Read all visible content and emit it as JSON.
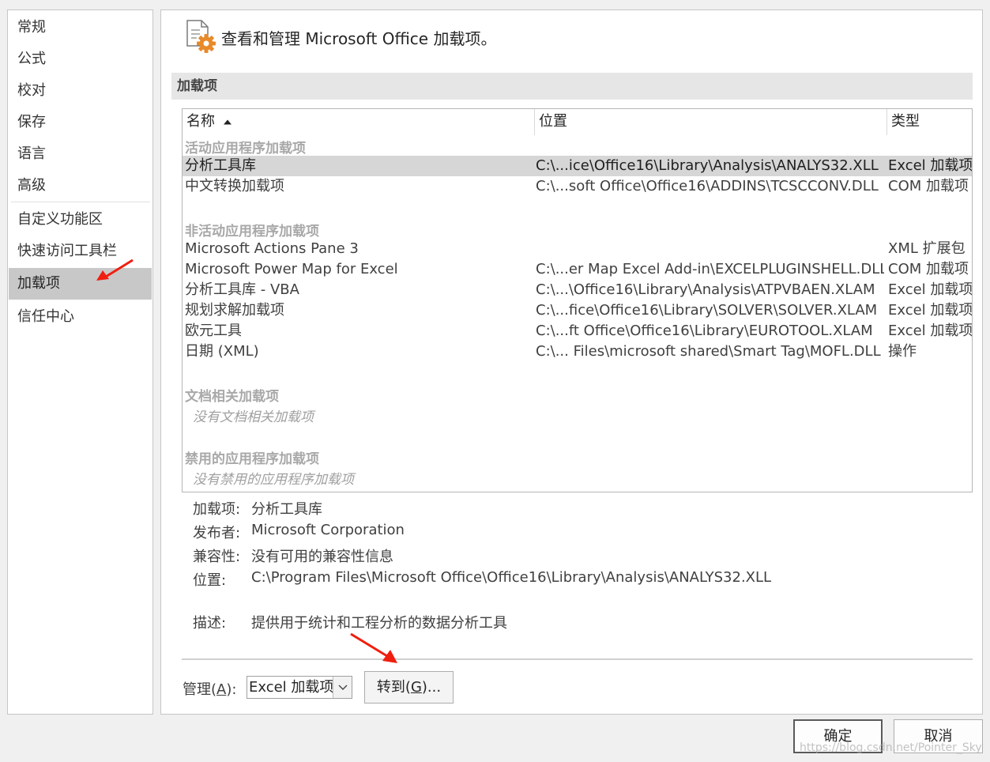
{
  "sidebar": {
    "items": [
      {
        "label": "常规"
      },
      {
        "label": "公式"
      },
      {
        "label": "校对"
      },
      {
        "label": "保存"
      },
      {
        "label": "语言"
      },
      {
        "label": "高级"
      },
      {
        "label": "自定义功能区"
      },
      {
        "label": "快速访问工具栏"
      },
      {
        "label": "加载项"
      },
      {
        "label": "信任中心"
      }
    ],
    "active_index": 8
  },
  "header": {
    "icon": "addins-gear-icon",
    "title": "查看和管理 Microsoft Office 加载项。"
  },
  "section": {
    "title": "加载项"
  },
  "table": {
    "columns": [
      {
        "label": "名称",
        "sort": "ascending"
      },
      {
        "label": "位置"
      },
      {
        "label": "类型"
      }
    ],
    "groups": [
      {
        "title": "活动应用程序加载项",
        "rows": [
          {
            "name": "分析工具库",
            "location": "C:\\...ice\\Office16\\Library\\Analysis\\ANALYS32.XLL",
            "type": "Excel 加载项",
            "selected": true
          },
          {
            "name": "中文转换加载项",
            "location": "C:\\...soft Office\\Office16\\ADDINS\\TCSCCONV.DLL",
            "type": "COM 加载项"
          }
        ]
      },
      {
        "title": "非活动应用程序加载项",
        "rows": [
          {
            "name": "Microsoft Actions Pane 3",
            "location": "",
            "type": "XML 扩展包"
          },
          {
            "name": "Microsoft Power Map for Excel",
            "location": "C:\\...er Map Excel Add-in\\EXCELPLUGINSHELL.DLL",
            "type": "COM 加载项"
          },
          {
            "name": "分析工具库 - VBA",
            "location": "C:\\...\\Office16\\Library\\Analysis\\ATPVBAEN.XLAM",
            "type": "Excel 加载项"
          },
          {
            "name": "规划求解加载项",
            "location": "C:\\...fice\\Office16\\Library\\SOLVER\\SOLVER.XLAM",
            "type": "Excel 加载项"
          },
          {
            "name": "欧元工具",
            "location": "C:\\...ft Office\\Office16\\Library\\EUROTOOL.XLAM",
            "type": "Excel 加载项"
          },
          {
            "name": "日期 (XML)",
            "location": "C:\\... Files\\microsoft shared\\Smart Tag\\MOFL.DLL",
            "type": "操作"
          }
        ]
      },
      {
        "title": "文档相关加载项",
        "empty_text": "没有文档相关加载项"
      },
      {
        "title": "禁用的应用程序加载项",
        "empty_text": "没有禁用的应用程序加载项"
      }
    ]
  },
  "details": {
    "addin_label": "加载项:",
    "addin_value": "分析工具库",
    "publisher_label": "发布者:",
    "publisher_value": "Microsoft Corporation",
    "compat_label": "兼容性:",
    "compat_value": "没有可用的兼容性信息",
    "location_label": "位置:",
    "location_value": "C:\\Program Files\\Microsoft Office\\Office16\\Library\\Analysis\\ANALYS32.XLL",
    "desc_label": "描述:",
    "desc_value": "提供用于统计和工程分析的数据分析工具"
  },
  "manage": {
    "label": "管理(A):",
    "label_pre": "管理(",
    "label_key": "A",
    "label_post": "):",
    "selected": "Excel 加载项",
    "goto_pre": "转到(",
    "goto_key": "G",
    "goto_post": ")..."
  },
  "footer": {
    "ok": "确定",
    "cancel": "取消"
  },
  "watermark": "https://blog.csdn.net/Pointer_Sky",
  "colors": {
    "annotation_arrow": "#f01e0f",
    "selection": "#d6d6d6",
    "active_nav": "#c8c8c8"
  }
}
